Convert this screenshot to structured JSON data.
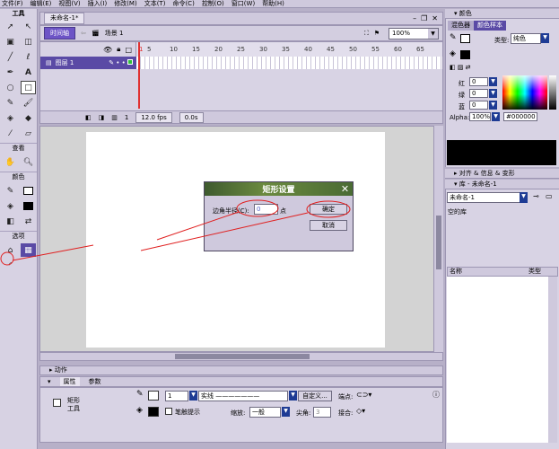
{
  "menu": [
    "文件(F)",
    "编辑(E)",
    "视图(V)",
    "插入(I)",
    "修改(M)",
    "文本(T)",
    "命令(C)",
    "控制(O)",
    "窗口(W)",
    "帮助(H)"
  ],
  "tools": {
    "title": "工具",
    "view_label": "查看",
    "colors_label": "颜色",
    "options_label": "选项"
  },
  "document": {
    "tab": "未命名-1*",
    "timeline_button": "时间轴",
    "scene": "场景 1",
    "zoom": "100%"
  },
  "timeline": {
    "layer_name": "图层 1",
    "ruler": [
      "1",
      "5",
      "10",
      "15",
      "20",
      "25",
      "30",
      "35",
      "40",
      "45",
      "50",
      "55",
      "60",
      "65"
    ],
    "frame": "1",
    "fps": "12.0 fps",
    "time": "0.0s"
  },
  "dialog": {
    "title": "矩形设置",
    "radius_label": "边角半径(C):",
    "radius_value": "0",
    "unit": "点",
    "ok": "确定",
    "cancel": "取消"
  },
  "panels": {
    "actions": "动作",
    "properties_tab": "属性",
    "params_tab": "参数",
    "tool_name": "矩形\n工具",
    "stroke_width": "1",
    "stroke_style": "实线",
    "custom_button": "自定义...",
    "endpoint_label": "端点:",
    "stroke_hint": "笔触提示",
    "scale_label": "缩放:",
    "scale_value": "一般",
    "miter_label": "尖角:",
    "miter_value": "3",
    "join_label": "接合:"
  },
  "color_panel": {
    "title": "颜色",
    "tab_mixer": "混色器",
    "tab_swatches": "颜色样本",
    "type_label": "类型:",
    "type_value": "纯色",
    "red_label": "红",
    "green_label": "绿",
    "blue_label": "蓝",
    "r": "0",
    "g": "0",
    "b": "0",
    "alpha_label": "Alpha:",
    "alpha": "100%",
    "hex": "#000000"
  },
  "align_panel": {
    "title": "对齐 & 信息 & 变形"
  },
  "library": {
    "title": "库 - 未命名-1",
    "doc": "未命名-1",
    "empty": "空的库",
    "col_name": "名称",
    "col_kind": "类型"
  }
}
